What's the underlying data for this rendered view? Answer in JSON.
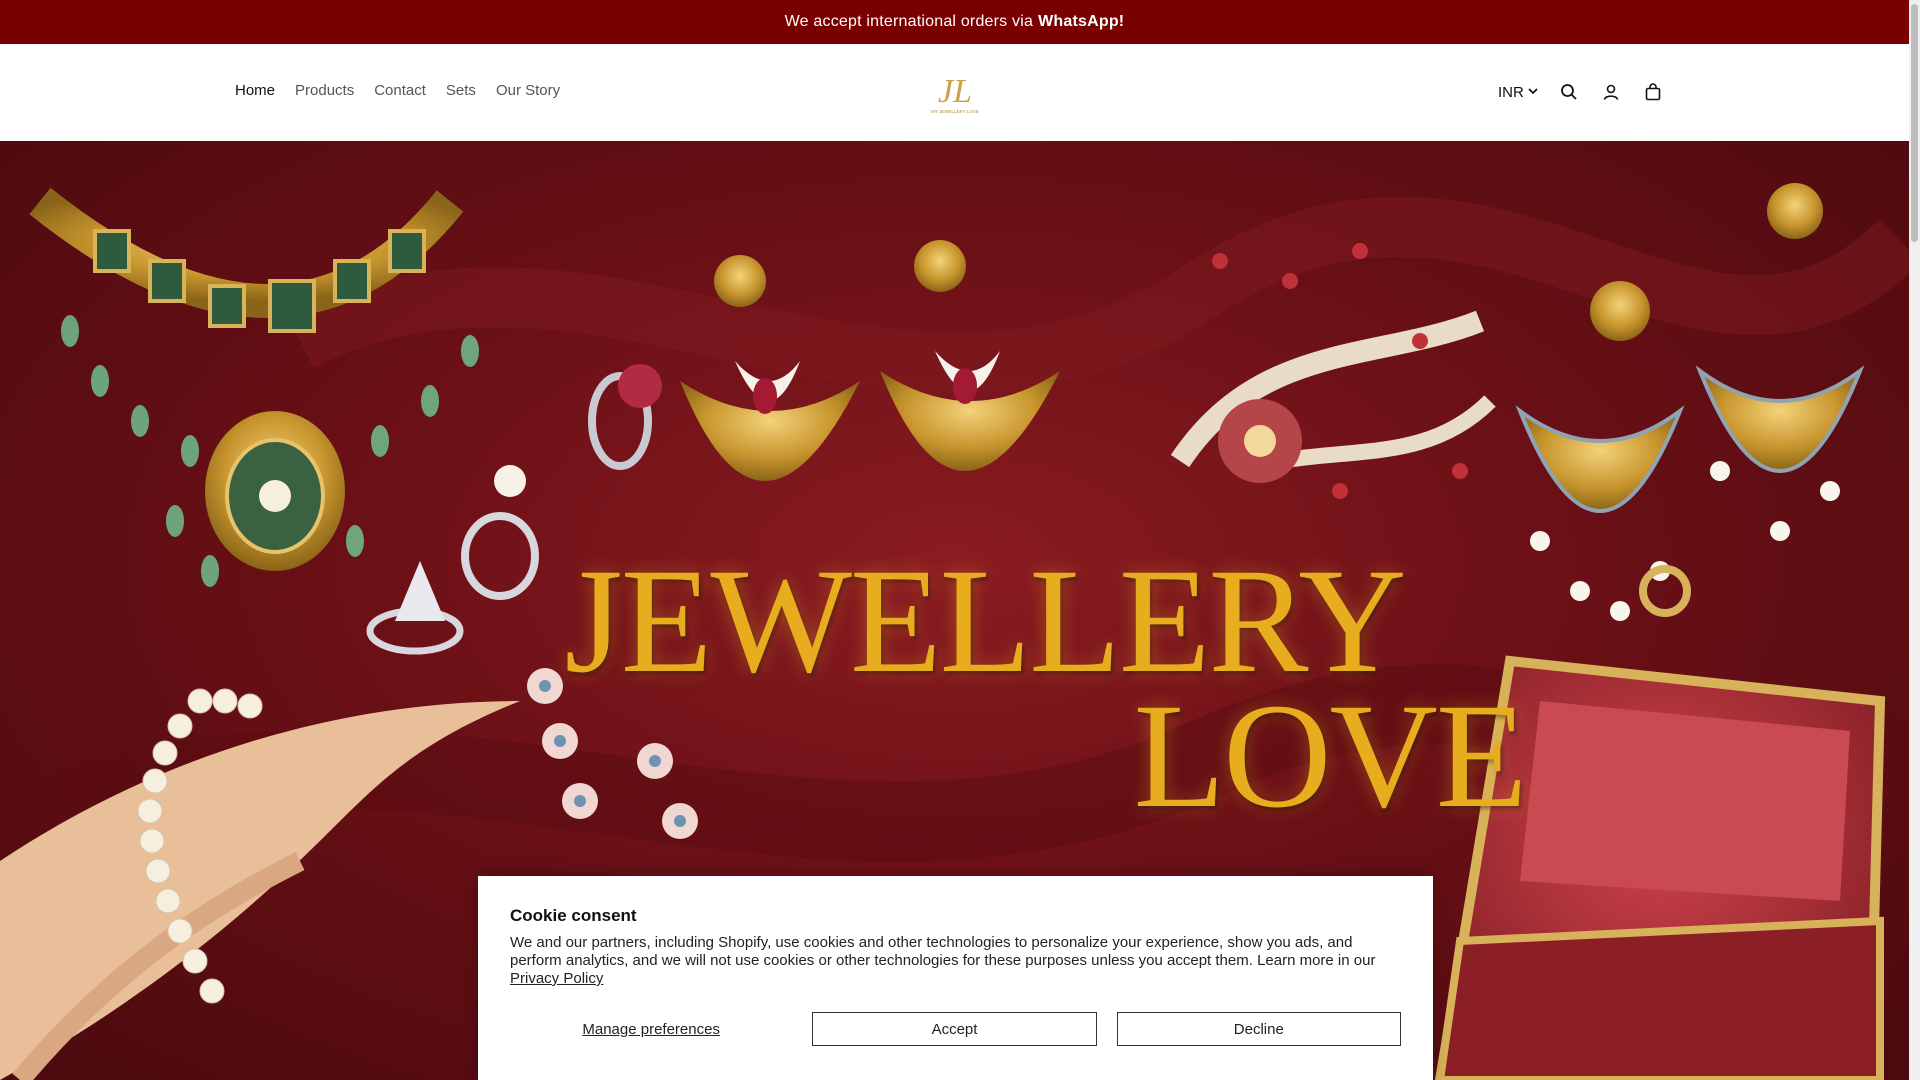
{
  "announcement": {
    "text": "We accept international orders via",
    "highlight": "WhatsApp!"
  },
  "nav": {
    "items": [
      {
        "label": "Home",
        "active": true
      },
      {
        "label": "Products",
        "active": false
      },
      {
        "label": "Contact",
        "active": false
      },
      {
        "label": "Sets",
        "active": false
      },
      {
        "label": "Our Story",
        "active": false
      }
    ]
  },
  "logo": {
    "monogram": "JL",
    "subtitle": "MY JEWELLERY LOVE"
  },
  "header_right": {
    "currency": "INR",
    "icons": [
      "search-icon",
      "account-icon",
      "cart-icon"
    ]
  },
  "hero": {
    "line1": "JEWELLERY",
    "line2": "LOVE"
  },
  "cookie": {
    "title": "Cookie consent",
    "body": "We and our partners, including Shopify, use cookies and other technologies to personalize your experience, show you ads, and perform analytics, and we will not use cookies or other technologies for these purposes unless you accept them. Learn more in our",
    "policy_link": "Privacy Policy",
    "manage_label": "Manage preferences",
    "accept_label": "Accept",
    "decline_label": "Decline"
  },
  "colors": {
    "announcement_bg": "#7a0000",
    "hero_bg": "#6a1016",
    "title_gold": "#e7ad1e"
  }
}
